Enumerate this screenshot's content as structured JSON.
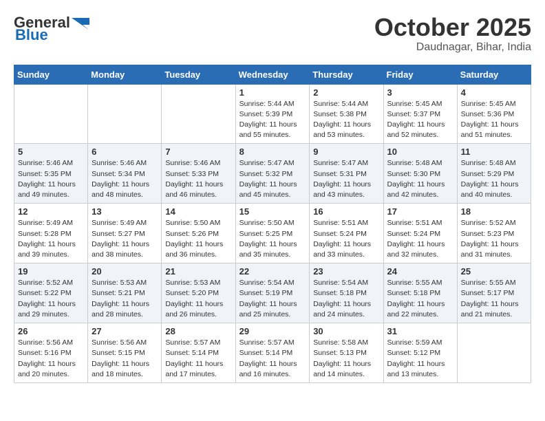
{
  "header": {
    "logo_general": "General",
    "logo_blue": "Blue",
    "month_title": "October 2025",
    "location": "Daudnagar, Bihar, India"
  },
  "weekdays": [
    "Sunday",
    "Monday",
    "Tuesday",
    "Wednesday",
    "Thursday",
    "Friday",
    "Saturday"
  ],
  "weeks": [
    [
      {
        "day": "",
        "info": ""
      },
      {
        "day": "",
        "info": ""
      },
      {
        "day": "",
        "info": ""
      },
      {
        "day": "1",
        "info": "Sunrise: 5:44 AM\nSunset: 5:39 PM\nDaylight: 11 hours\nand 55 minutes."
      },
      {
        "day": "2",
        "info": "Sunrise: 5:44 AM\nSunset: 5:38 PM\nDaylight: 11 hours\nand 53 minutes."
      },
      {
        "day": "3",
        "info": "Sunrise: 5:45 AM\nSunset: 5:37 PM\nDaylight: 11 hours\nand 52 minutes."
      },
      {
        "day": "4",
        "info": "Sunrise: 5:45 AM\nSunset: 5:36 PM\nDaylight: 11 hours\nand 51 minutes."
      }
    ],
    [
      {
        "day": "5",
        "info": "Sunrise: 5:46 AM\nSunset: 5:35 PM\nDaylight: 11 hours\nand 49 minutes."
      },
      {
        "day": "6",
        "info": "Sunrise: 5:46 AM\nSunset: 5:34 PM\nDaylight: 11 hours\nand 48 minutes."
      },
      {
        "day": "7",
        "info": "Sunrise: 5:46 AM\nSunset: 5:33 PM\nDaylight: 11 hours\nand 46 minutes."
      },
      {
        "day": "8",
        "info": "Sunrise: 5:47 AM\nSunset: 5:32 PM\nDaylight: 11 hours\nand 45 minutes."
      },
      {
        "day": "9",
        "info": "Sunrise: 5:47 AM\nSunset: 5:31 PM\nDaylight: 11 hours\nand 43 minutes."
      },
      {
        "day": "10",
        "info": "Sunrise: 5:48 AM\nSunset: 5:30 PM\nDaylight: 11 hours\nand 42 minutes."
      },
      {
        "day": "11",
        "info": "Sunrise: 5:48 AM\nSunset: 5:29 PM\nDaylight: 11 hours\nand 40 minutes."
      }
    ],
    [
      {
        "day": "12",
        "info": "Sunrise: 5:49 AM\nSunset: 5:28 PM\nDaylight: 11 hours\nand 39 minutes."
      },
      {
        "day": "13",
        "info": "Sunrise: 5:49 AM\nSunset: 5:27 PM\nDaylight: 11 hours\nand 38 minutes."
      },
      {
        "day": "14",
        "info": "Sunrise: 5:50 AM\nSunset: 5:26 PM\nDaylight: 11 hours\nand 36 minutes."
      },
      {
        "day": "15",
        "info": "Sunrise: 5:50 AM\nSunset: 5:25 PM\nDaylight: 11 hours\nand 35 minutes."
      },
      {
        "day": "16",
        "info": "Sunrise: 5:51 AM\nSunset: 5:24 PM\nDaylight: 11 hours\nand 33 minutes."
      },
      {
        "day": "17",
        "info": "Sunrise: 5:51 AM\nSunset: 5:24 PM\nDaylight: 11 hours\nand 32 minutes."
      },
      {
        "day": "18",
        "info": "Sunrise: 5:52 AM\nSunset: 5:23 PM\nDaylight: 11 hours\nand 31 minutes."
      }
    ],
    [
      {
        "day": "19",
        "info": "Sunrise: 5:52 AM\nSunset: 5:22 PM\nDaylight: 11 hours\nand 29 minutes."
      },
      {
        "day": "20",
        "info": "Sunrise: 5:53 AM\nSunset: 5:21 PM\nDaylight: 11 hours\nand 28 minutes."
      },
      {
        "day": "21",
        "info": "Sunrise: 5:53 AM\nSunset: 5:20 PM\nDaylight: 11 hours\nand 26 minutes."
      },
      {
        "day": "22",
        "info": "Sunrise: 5:54 AM\nSunset: 5:19 PM\nDaylight: 11 hours\nand 25 minutes."
      },
      {
        "day": "23",
        "info": "Sunrise: 5:54 AM\nSunset: 5:18 PM\nDaylight: 11 hours\nand 24 minutes."
      },
      {
        "day": "24",
        "info": "Sunrise: 5:55 AM\nSunset: 5:18 PM\nDaylight: 11 hours\nand 22 minutes."
      },
      {
        "day": "25",
        "info": "Sunrise: 5:55 AM\nSunset: 5:17 PM\nDaylight: 11 hours\nand 21 minutes."
      }
    ],
    [
      {
        "day": "26",
        "info": "Sunrise: 5:56 AM\nSunset: 5:16 PM\nDaylight: 11 hours\nand 20 minutes."
      },
      {
        "day": "27",
        "info": "Sunrise: 5:56 AM\nSunset: 5:15 PM\nDaylight: 11 hours\nand 18 minutes."
      },
      {
        "day": "28",
        "info": "Sunrise: 5:57 AM\nSunset: 5:14 PM\nDaylight: 11 hours\nand 17 minutes."
      },
      {
        "day": "29",
        "info": "Sunrise: 5:57 AM\nSunset: 5:14 PM\nDaylight: 11 hours\nand 16 minutes."
      },
      {
        "day": "30",
        "info": "Sunrise: 5:58 AM\nSunset: 5:13 PM\nDaylight: 11 hours\nand 14 minutes."
      },
      {
        "day": "31",
        "info": "Sunrise: 5:59 AM\nSunset: 5:12 PM\nDaylight: 11 hours\nand 13 minutes."
      },
      {
        "day": "",
        "info": ""
      }
    ]
  ]
}
